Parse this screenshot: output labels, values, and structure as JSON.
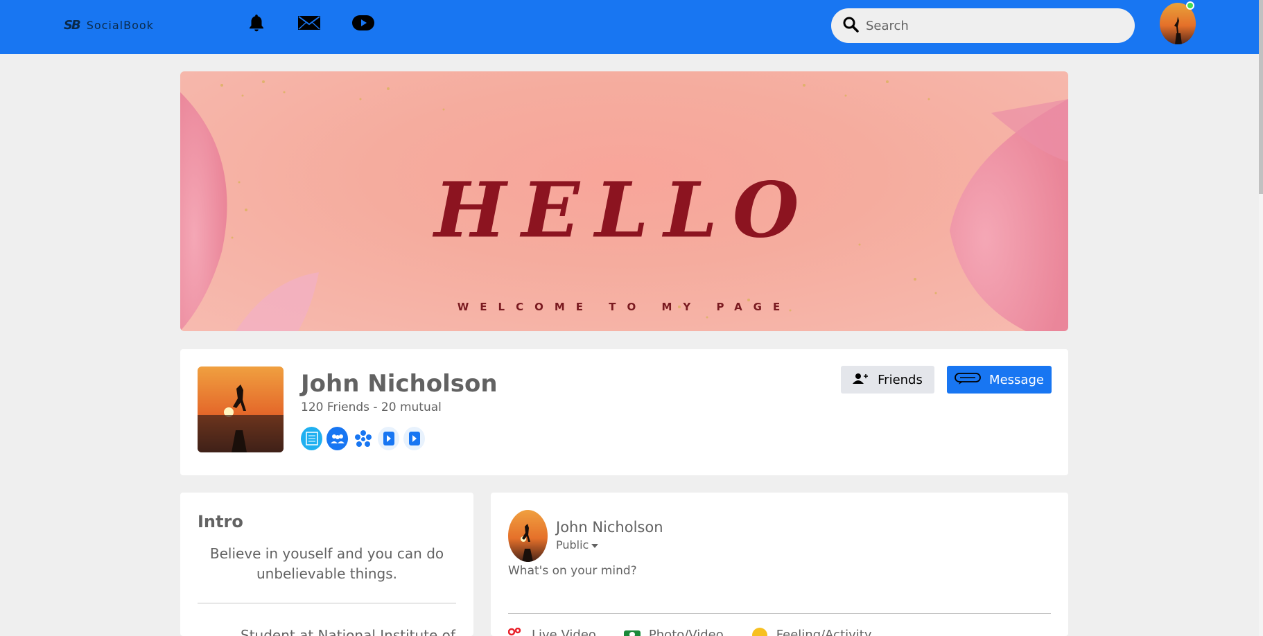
{
  "navbar": {
    "logo_mark": "SB",
    "logo_text": "SocialBook",
    "icons": [
      "bell-icon",
      "mail-icon",
      "youtube-play-icon"
    ],
    "search_placeholder": "Search",
    "brand_color": "#1876f2"
  },
  "cover": {
    "heading": "HELLO",
    "subheading": "WELCOME TO MY PAGE"
  },
  "profile": {
    "name": "John Nicholson",
    "friends_text": "120 Friends - 20 mutual",
    "friend_icons": [
      "news-icon",
      "group-icon",
      "community-icon",
      "play-icon",
      "play-icon"
    ],
    "friends_button": "Friends",
    "message_button": "Message"
  },
  "intro": {
    "title": "Intro",
    "quote": "Believe in youself and you can do unbelievable things.",
    "education": "Student at National Institute of"
  },
  "composer": {
    "name": "John Nicholson",
    "privacy": "Public",
    "placeholder": "What's on your mind?",
    "actions": [
      {
        "label": "Live Video",
        "icon": "live-video-icon"
      },
      {
        "label": "Photo/Video",
        "icon": "photo-icon"
      },
      {
        "label": "Feeling/Activity",
        "icon": "feeling-icon"
      }
    ]
  },
  "colors": {
    "accent": "#1876f2",
    "background": "#efefef",
    "online": "#41db51"
  }
}
